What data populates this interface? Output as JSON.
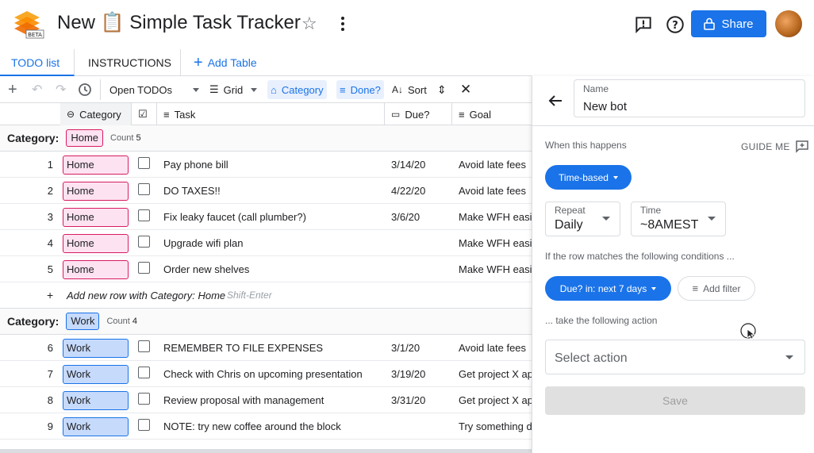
{
  "header": {
    "title": "New 📋 Simple Task Tracker",
    "logo_badge": "BETA",
    "share_label": "Share"
  },
  "tabs": [
    {
      "label": "TODO list",
      "active": true
    },
    {
      "label": "INSTRUCTIONS",
      "active": false
    },
    {
      "label": "Add Table",
      "active": false
    }
  ],
  "toolbar": {
    "view": "Open TODOs",
    "layout": "Grid",
    "group": "Category",
    "filter": "Done?",
    "sort": "Sort"
  },
  "columns": [
    "Category",
    "Task",
    "Due?",
    "Goal"
  ],
  "groups": [
    {
      "label": "Category:",
      "chip": "Home",
      "count_label": "Count",
      "count": "5",
      "rows": [
        {
          "n": "1",
          "category": "Home",
          "task": "Pay phone bill",
          "due": "3/14/20",
          "goal": "Avoid late fees"
        },
        {
          "n": "2",
          "category": "Home",
          "task": "DO TAXES!!",
          "due": "4/22/20",
          "goal": "Avoid late fees"
        },
        {
          "n": "3",
          "category": "Home",
          "task": "Fix leaky faucet (call plumber?)",
          "due": "3/6/20",
          "goal": "Make WFH easier"
        },
        {
          "n": "4",
          "category": "Home",
          "task": "Upgrade wifi plan",
          "due": "",
          "goal": "Make WFH easier"
        },
        {
          "n": "5",
          "category": "Home",
          "task": "Order new shelves",
          "due": "",
          "goal": "Make WFH easier"
        }
      ],
      "add_row": {
        "plus": "+",
        "text": "Add new row with Category: Home",
        "hint": "Shift-Enter"
      }
    },
    {
      "label": "Category:",
      "chip": "Work",
      "count_label": "Count",
      "count": "4",
      "rows": [
        {
          "n": "6",
          "category": "Work",
          "task": "REMEMBER TO FILE EXPENSES",
          "due": "3/1/20",
          "goal": "Avoid late fees"
        },
        {
          "n": "7",
          "category": "Work",
          "task": "Check with Chris on upcoming presentation",
          "due": "3/19/20",
          "goal": "Get project X approved"
        },
        {
          "n": "8",
          "category": "Work",
          "task": "Review proposal with management",
          "due": "3/31/20",
          "goal": "Get project X approved"
        },
        {
          "n": "9",
          "category": "Work",
          "task": "NOTE: try new coffee around the block",
          "due": "",
          "goal": "Try something different"
        }
      ]
    }
  ],
  "panel": {
    "name_label": "Name",
    "name_value": "New bot",
    "when_label": "When this happens",
    "guide_label": "GUIDE ME",
    "trigger_pill": "Time-based",
    "repeat_label": "Repeat",
    "repeat_value": "Daily",
    "time_label": "Time",
    "time_value": "~8AMEST",
    "conditions_label": "If the row matches the following conditions ...",
    "condition_pill": "Due? in: next 7 days",
    "add_filter_label": "Add filter",
    "action_label": "... take the following action",
    "select_action_placeholder": "Select action",
    "save_label": "Save"
  },
  "colors": {
    "accent": "#1a73e8",
    "home_chip": "#fde2f2",
    "home_border": "#d81b60",
    "work_chip": "#c6dafc"
  }
}
